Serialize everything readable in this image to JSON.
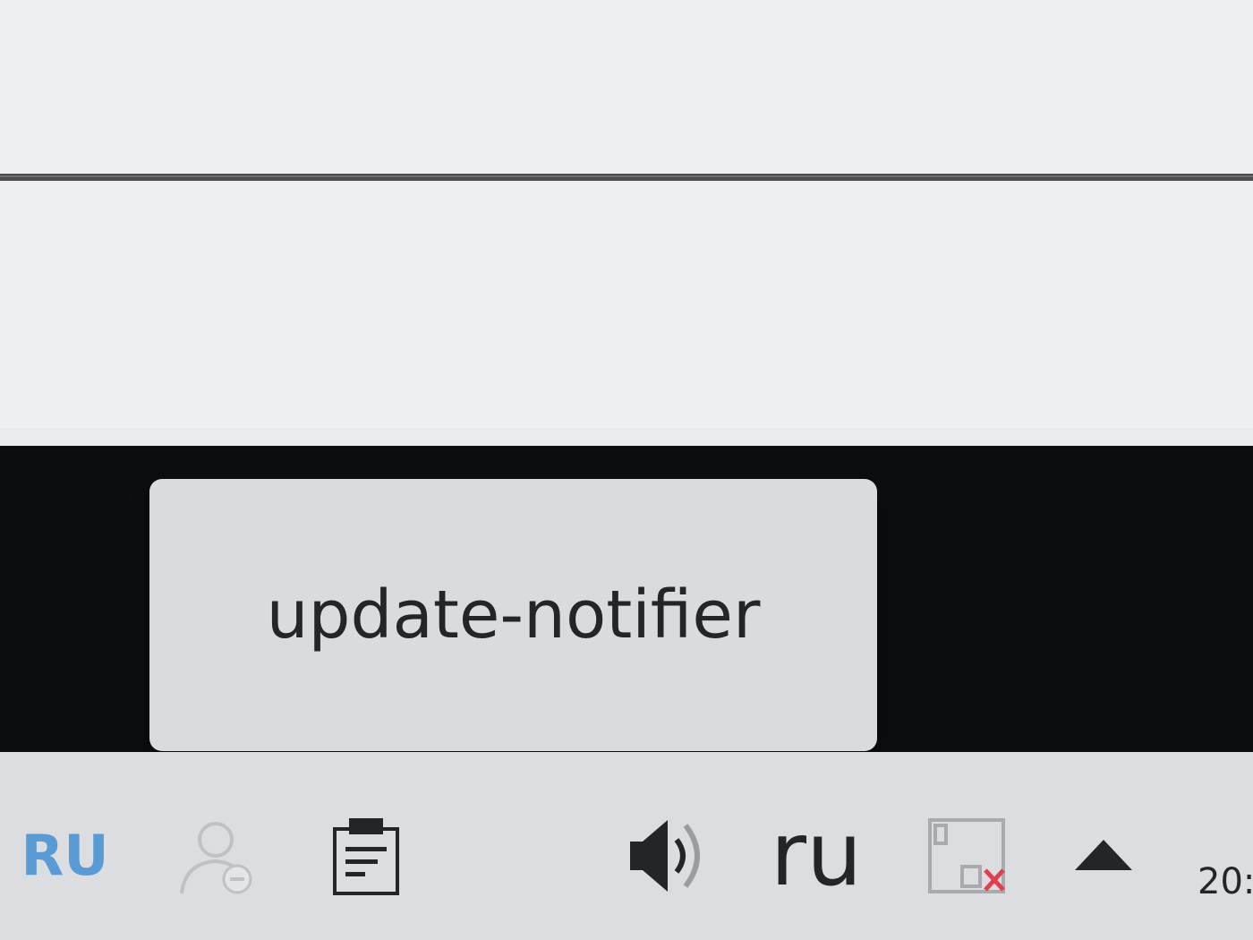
{
  "tooltip": {
    "text": "update-notifier"
  },
  "tray": {
    "layout_indicator": "RU",
    "keyboard_layout": "ru",
    "clock_partial": "20:",
    "icons": [
      "user-status-icon",
      "clipboard-icon",
      "volume-icon",
      "network-disconnected-icon",
      "expand-arrow-icon"
    ]
  },
  "colors": {
    "window_bg": "#eff0f1",
    "desktop_bg": "#0b0d11",
    "panel_bg": "#dcdde0",
    "tooltip_bg": "#dadbdd",
    "accent_blue": "#5b9bd5",
    "error_red": "#e0404a",
    "text": "#232629"
  }
}
